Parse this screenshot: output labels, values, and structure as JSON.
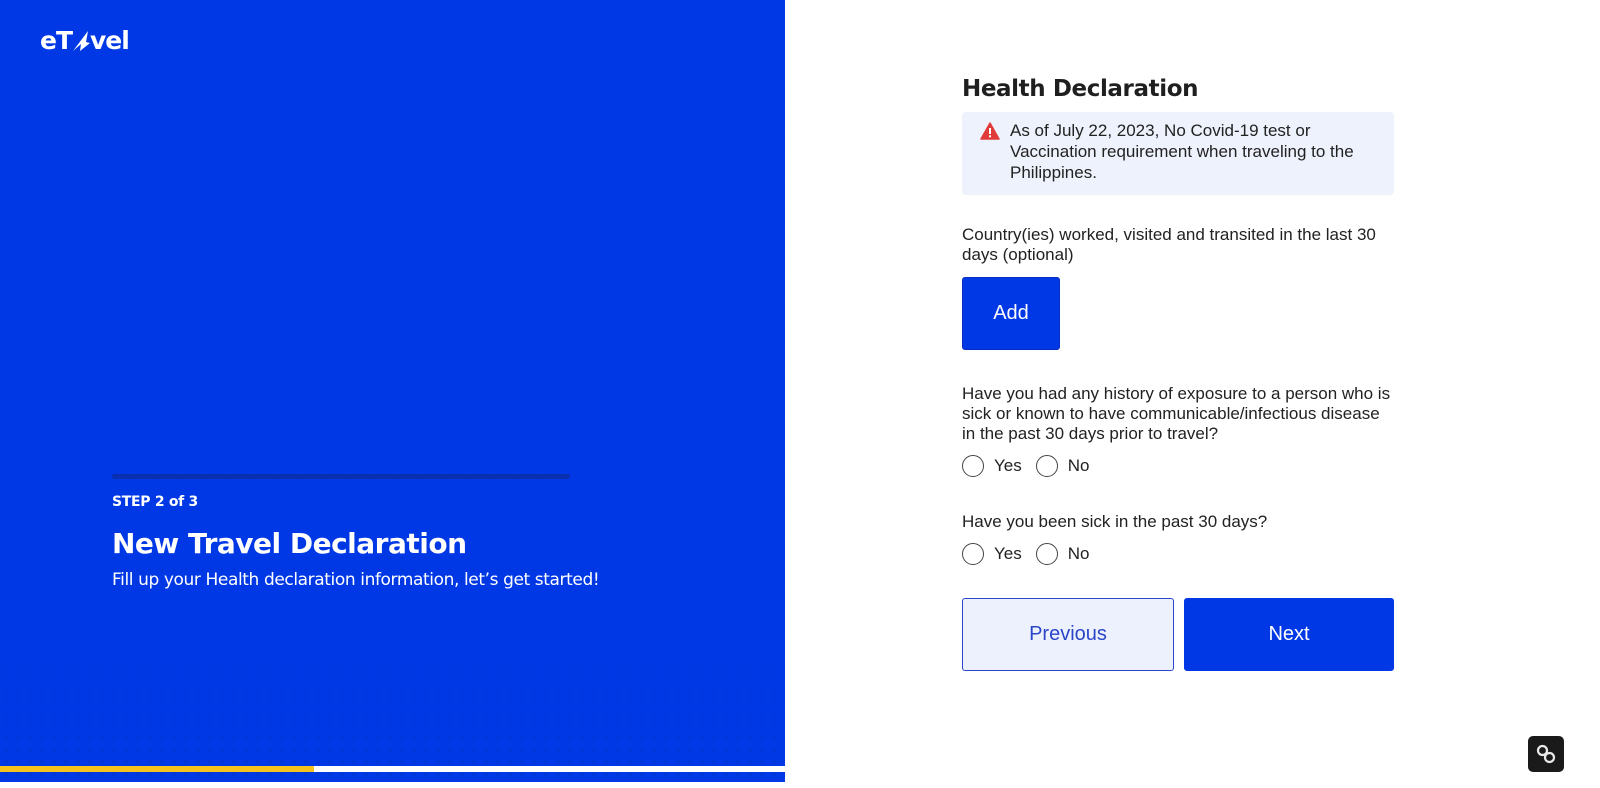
{
  "brand": {
    "logo_text_prefix": "eT",
    "logo_text_suffix": "vel",
    "primary_color": "#0138e6",
    "accent_color": "#f7c21b"
  },
  "left_panel": {
    "step_label": "STEP 2 of 3",
    "title": "New Travel Declaration",
    "subtitle": "Fill up your Health declaration information, let’s get started!",
    "bottom_progress_fraction": 0.4
  },
  "form": {
    "title": "Health Declaration",
    "alert": {
      "icon": "warning-icon",
      "text": "As of July 22, 2023, No Covid-19 test or Vaccination requirement when traveling to the Philippines."
    },
    "countries": {
      "label": "Country(ies) worked, visited and transited in the last 30 days (optional)",
      "add_label": "Add"
    },
    "exposure": {
      "question": "Have you had any history of exposure to a person who is sick or known to have communicable/infectious disease in the past 30 days prior to travel?",
      "yes_label": "Yes",
      "no_label": "No"
    },
    "sick": {
      "question": "Have you been sick in the past 30 days?",
      "yes_label": "Yes",
      "no_label": "No"
    },
    "previous_label": "Previous",
    "next_label": "Next"
  },
  "widget": {
    "icon": "link-icon"
  }
}
